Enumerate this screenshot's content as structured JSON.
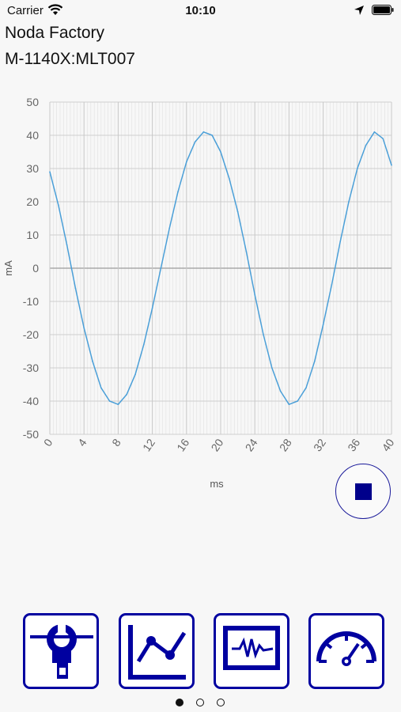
{
  "status_bar": {
    "carrier": "Carrier",
    "time": "10:10"
  },
  "header": {
    "factory": "Noda Factory",
    "device": "M-1140X:MLT007"
  },
  "chart_data": {
    "type": "line",
    "title": "",
    "xlabel": "ms",
    "ylabel": "mA",
    "xlim": [
      0,
      40
    ],
    "ylim": [
      -50,
      50
    ],
    "x_ticks": [
      "0",
      "4",
      "8",
      "12",
      "16",
      "20",
      "24",
      "28",
      "32",
      "36",
      "40"
    ],
    "y_ticks": [
      "50",
      "40",
      "30",
      "20",
      "10",
      "0",
      "-10",
      "-20",
      "-30",
      "-40",
      "-50"
    ],
    "grid": true,
    "series": [
      {
        "color": "#4a9fd8",
        "x": [
          0,
          1,
          2,
          3,
          4,
          5,
          6,
          7,
          8,
          9,
          10,
          11,
          12,
          13,
          14,
          15,
          16,
          17,
          18,
          19,
          20,
          21,
          22,
          23,
          24,
          25,
          26,
          27,
          28,
          29,
          30,
          31,
          32,
          33,
          34,
          35,
          36,
          37,
          38,
          39,
          40
        ],
        "y": [
          29,
          19,
          7,
          -6,
          -18,
          -28,
          -36,
          -40,
          -41,
          -38,
          -32,
          -23,
          -12,
          0,
          12,
          23,
          32,
          38,
          41,
          40,
          35,
          27,
          17,
          5,
          -8,
          -20,
          -30,
          -37,
          -41,
          -40,
          -36,
          -28,
          -17,
          -5,
          8,
          20,
          30,
          37,
          41,
          39,
          31
        ]
      }
    ]
  },
  "controls": {
    "stop_label": "stop"
  },
  "app_icons": [
    {
      "name": "clamp-meter"
    },
    {
      "name": "trend-graph"
    },
    {
      "name": "waveform"
    },
    {
      "name": "gauge"
    }
  ],
  "page_indicator": {
    "count": 3,
    "active": 0
  }
}
